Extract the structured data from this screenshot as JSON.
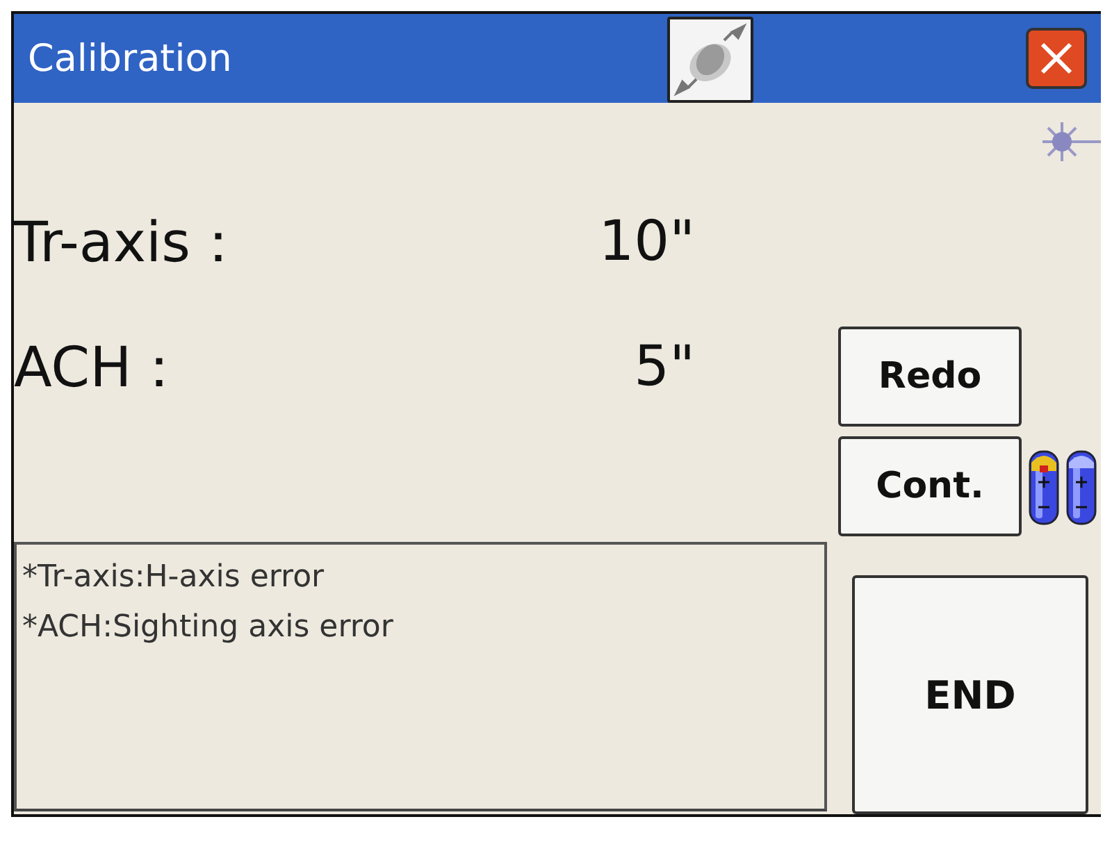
{
  "window": {
    "title": "Calibration"
  },
  "readings": [
    {
      "label": "Tr-axis：",
      "value": "10\""
    },
    {
      "label": "ACH：",
      "value": "5\""
    }
  ],
  "notes": [
    "*Tr-axis:H-axis error",
    "*ACH:Sighting axis error"
  ],
  "buttons": [
    {
      "kind": "redo",
      "label": "Redo"
    },
    {
      "kind": "cont",
      "label": "Cont."
    },
    {
      "kind": "end",
      "label": "END"
    }
  ]
}
